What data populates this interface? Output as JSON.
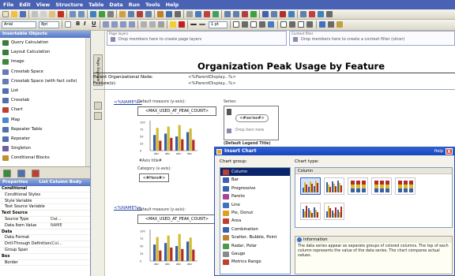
{
  "menu": [
    "File",
    "Edit",
    "View",
    "Structure",
    "Table",
    "Data",
    "Run",
    "Tools",
    "Help"
  ],
  "format_toolbar": {
    "font": "Arial",
    "size": "8pt",
    "bold": "B",
    "italic": "I",
    "underline": "U",
    "line_width": "1 pt"
  },
  "left_panel": {
    "title": "Insertable Objects",
    "items": [
      {
        "label": "Query Calculation",
        "icon": "query-calculation-icon",
        "color": "#3a7d3a"
      },
      {
        "label": "Layout Calculation",
        "icon": "layout-calculation-icon",
        "color": "#3a7d3a"
      },
      {
        "label": "Image",
        "icon": "image-icon",
        "color": "#3a8a3a"
      },
      {
        "label": "Crosstab Space",
        "icon": "crosstab-space-icon",
        "color": "#6a7ab8"
      },
      {
        "label": "Crosstab Space (with fact cells)",
        "icon": "crosstab-space-fact-icon",
        "color": "#6a7ab8"
      },
      {
        "label": "List",
        "icon": "list-icon",
        "color": "#5070b0"
      },
      {
        "label": "Crosstab",
        "icon": "crosstab-icon",
        "color": "#5070b0"
      },
      {
        "label": "Chart",
        "icon": "chart-icon",
        "color": "#c04030"
      },
      {
        "label": "Map",
        "icon": "map-icon",
        "color": "#4a8ad0"
      },
      {
        "label": "Repeater Table",
        "icon": "repeater-table-icon",
        "color": "#5070b0"
      },
      {
        "label": "Repeater",
        "icon": "repeater-icon",
        "color": "#5070b0"
      },
      {
        "label": "Singleton",
        "icon": "singleton-icon",
        "color": "#7060a0"
      },
      {
        "label": "Conditional Blocks",
        "icon": "conditional-blocks-icon",
        "color": "#c09030"
      }
    ]
  },
  "properties": {
    "title": "Properties",
    "subtitle": "List Column Body",
    "rows": [
      {
        "k": "Conditional",
        "v": "",
        "section": true
      },
      {
        "k": "Conditional Styles",
        "v": ""
      },
      {
        "k": "Style Variable",
        "v": ""
      },
      {
        "k": "Text Source Variable",
        "v": ""
      },
      {
        "k": "Text Source",
        "v": "",
        "section": true
      },
      {
        "k": "Source Type",
        "v": "Dat..."
      },
      {
        "k": "Data Item Value",
        "v": "NAME"
      },
      {
        "k": "Data",
        "v": "",
        "section": true
      },
      {
        "k": "Data Format",
        "v": ""
      },
      {
        "k": "Drill-Through Definitions",
        "v": "(Col..."
      },
      {
        "k": "Group Span",
        "v": ""
      },
      {
        "k": "Box",
        "v": "",
        "section": true
      },
      {
        "k": "Border",
        "v": ""
      }
    ]
  },
  "workspace": {
    "page_layers": "Page layers",
    "page_layers_hint": "Drop members here to create page layers",
    "context_filter": "Context filter",
    "context_filter_hint": "Drop members here to create a context filter (slicer)",
    "page_explorer": "Page Explorer",
    "report_title": "Organization Peak Usage by Feature",
    "param1_label": "Parent Organizational Node:",
    "param1_value": "<%ParentDisplay...%>",
    "param2_label": "Feature(s):",
    "param2_value": "<%ParentDisplay...%>",
    "name_label": "<%NAME%>",
    "default_measure_label": "Default measure (y-axis):",
    "default_measure_value": "<MAX_USED_AT_PEAK_COUNT>",
    "series_label": "Series:",
    "series_value": "<#series#>",
    "drop_items": "Drop item here",
    "legend_title": "(Default Legend Title)",
    "axis_title": "#Axis title#",
    "category_label": "Category (x-axis):",
    "category_value": "<#Here#>",
    "tick": "abc"
  },
  "dialog": {
    "title": "Insert Chart",
    "help": "Help",
    "close": "X",
    "chart_group_label": "Chart group:",
    "chart_type_label": "Chart type:",
    "groups": [
      {
        "label": "Column",
        "icon": "column-chart-icon",
        "color": "#c04030",
        "selected": true
      },
      {
        "label": "Bar",
        "icon": "bar-chart-icon",
        "color": "#3a60b0"
      },
      {
        "label": "Progressive",
        "icon": "progressive-chart-icon",
        "color": "#3a60b0"
      },
      {
        "label": "Pareto",
        "icon": "pareto-chart-icon",
        "color": "#b04090"
      },
      {
        "label": "Line",
        "icon": "line-chart-icon",
        "color": "#4070c0"
      },
      {
        "label": "Pie, Donut",
        "icon": "pie-chart-icon",
        "color": "#e0a020"
      },
      {
        "label": "Area",
        "icon": "area-chart-icon",
        "color": "#c04030"
      },
      {
        "label": "Combination",
        "icon": "combination-chart-icon",
        "color": "#3a60b0"
      },
      {
        "label": "Scatter, Bubble, Point",
        "icon": "scatter-chart-icon",
        "color": "#c08030"
      },
      {
        "label": "Radar, Polar",
        "icon": "radar-chart-icon",
        "color": "#4a9a4a"
      },
      {
        "label": "Gauge",
        "icon": "gauge-chart-icon",
        "color": "#8a8a8a"
      },
      {
        "label": "Metrics Range",
        "icon": "metrics-range-icon",
        "color": "#c04030"
      }
    ],
    "type_header": "Column",
    "info_title": "Information",
    "info_text": "The data series appear as separate groups of colored columns. The top of each column represents the value of the data series. The chart compares actual values."
  },
  "colors": {
    "series1": "#3a5fa8",
    "series2": "#d2bd35",
    "series3": "#b32b22",
    "accent": "#2a62d8"
  }
}
